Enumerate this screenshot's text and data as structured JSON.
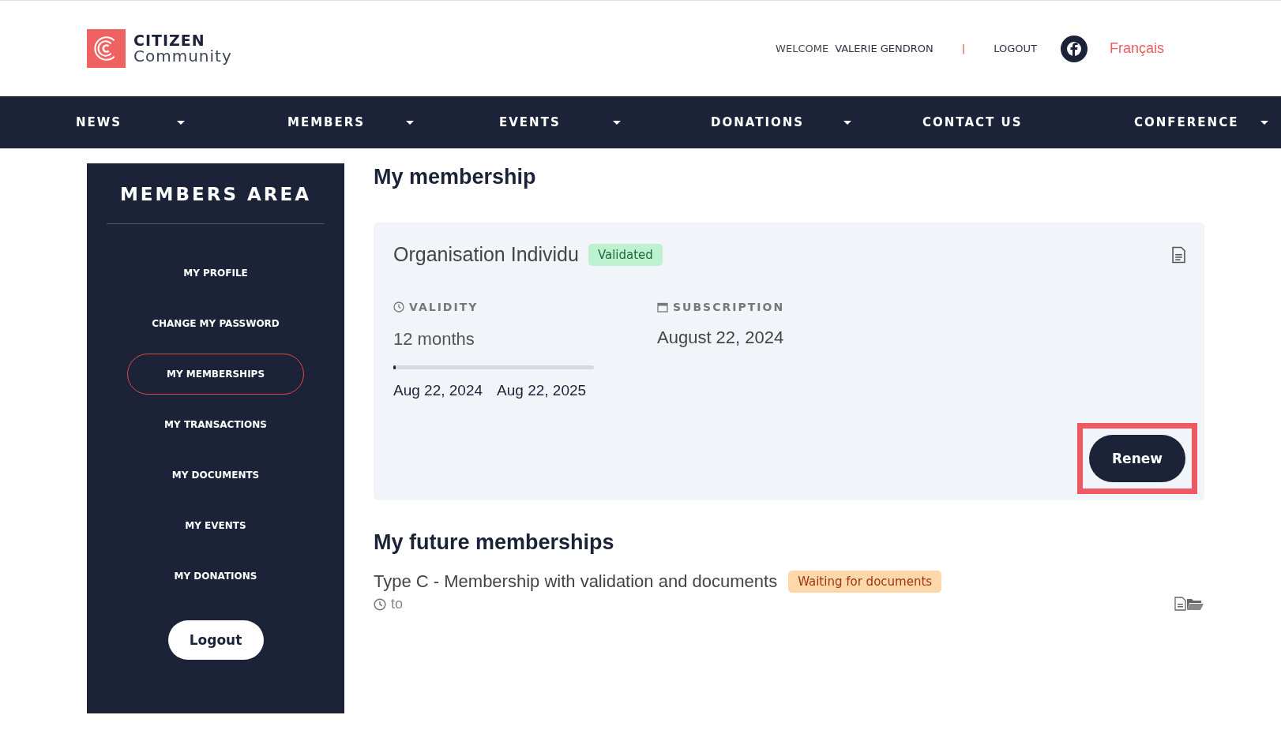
{
  "header": {
    "logo": {
      "line_1": "CITIZEN",
      "line_2": "Community"
    },
    "welcome": "WELCOME",
    "user": "VALERIE GENDRON",
    "separator": "|",
    "logout": "LOGOUT",
    "language": "Français"
  },
  "nav": [
    {
      "label": "NEWS",
      "dropdown": true
    },
    {
      "label": "MEMBERS",
      "dropdown": true
    },
    {
      "label": "EVENTS",
      "dropdown": true
    },
    {
      "label": "DONATIONS",
      "dropdown": true
    },
    {
      "label": "CONTACT US",
      "dropdown": false
    },
    {
      "label": "CONFERENCE",
      "dropdown": true
    }
  ],
  "sidebar": {
    "title": "MEMBERS AREA",
    "items": [
      {
        "label": "MY PROFILE",
        "selected": false
      },
      {
        "label": "CHANGE MY PASSWORD",
        "selected": false
      },
      {
        "label": "MY MEMBERSHIPS",
        "selected": true
      },
      {
        "label": "MY TRANSACTIONS",
        "selected": false
      },
      {
        "label": "MY DOCUMENTS",
        "selected": false
      },
      {
        "label": "MY EVENTS",
        "selected": false
      },
      {
        "label": "MY DONATIONS",
        "selected": false
      }
    ],
    "logout": "Logout"
  },
  "membership": {
    "title": "My membership",
    "name": "Organisation Individu",
    "status": {
      "label": "Validated",
      "kind": "success"
    },
    "validity_label": "VALIDITY",
    "validity": "12 months",
    "level": 0.01,
    "start": "Aug 22, 2024",
    "end": "Aug 22, 2025",
    "subscription_label": "SUBSCRIPTION",
    "subscription": "August 22, 2024",
    "renew": "Renew",
    "renew_highlighted": true
  },
  "future": {
    "title": "My future memberships",
    "items": [
      {
        "name": "Type C - Membership with validation and documents",
        "status": {
          "label": "Waiting for documents",
          "kind": "warning"
        },
        "dates": "to"
      }
    ]
  }
}
